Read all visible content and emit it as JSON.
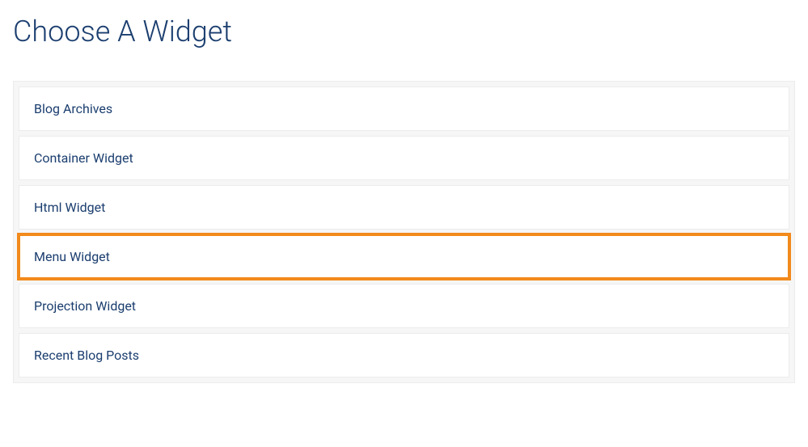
{
  "page": {
    "title": "Choose A Widget"
  },
  "widgets": {
    "items": [
      {
        "label": "Blog Archives",
        "highlighted": false
      },
      {
        "label": "Container Widget",
        "highlighted": false
      },
      {
        "label": "Html Widget",
        "highlighted": false
      },
      {
        "label": "Menu Widget",
        "highlighted": true
      },
      {
        "label": "Projection Widget",
        "highlighted": false
      },
      {
        "label": "Recent Blog Posts",
        "highlighted": false
      }
    ]
  }
}
